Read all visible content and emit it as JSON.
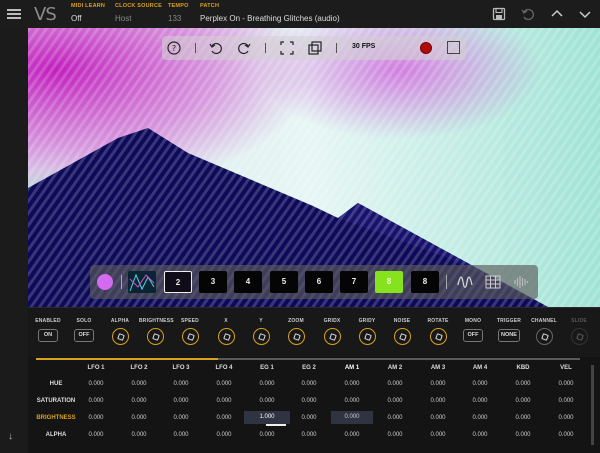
{
  "header": {
    "logo": "VS",
    "fields": [
      {
        "label": "MIDI LEARN",
        "value": "Off"
      },
      {
        "label": "CLOCK SOURCE",
        "value": "Host"
      },
      {
        "label": "TEMPO",
        "value": "133"
      },
      {
        "label": "PATCH",
        "value": "Perplex On - Breathing Glitches (audio)"
      }
    ],
    "icons": [
      "save-icon",
      "undo-icon",
      "chevron-up-icon",
      "chevron-down-icon"
    ]
  },
  "preview_toolbar": {
    "fps": "30 FPS",
    "icons": [
      "help-icon",
      "undo-icon",
      "redo-icon",
      "fullscreen-icon",
      "copy-icon",
      "record-icon",
      "stop-icon"
    ],
    "colors": {
      "record": "#b00c0c"
    }
  },
  "state_bar": {
    "color_swatch": "#d36bf0",
    "slots": [
      "2",
      "3",
      "4",
      "5",
      "6",
      "7",
      "8",
      "8"
    ],
    "selected_slot": "2",
    "highlighted_slot_color": "#86e21d",
    "icons": [
      "waveform-icon",
      "grid-icon",
      "audio-bars-icon"
    ]
  },
  "controls": [
    {
      "label": "ENABLED",
      "type": "button",
      "value": "ON"
    },
    {
      "label": "SOLO",
      "type": "button",
      "value": "OFF"
    },
    {
      "label": "ALPHA",
      "type": "knob"
    },
    {
      "label": "BRIGHTNESS",
      "type": "knob"
    },
    {
      "label": "SPEED",
      "type": "knob"
    },
    {
      "label": "X",
      "type": "knob"
    },
    {
      "label": "Y",
      "type": "knob"
    },
    {
      "label": "ZOOM",
      "type": "knob"
    },
    {
      "label": "GRIDX",
      "type": "knob"
    },
    {
      "label": "GRIDY",
      "type": "knob"
    },
    {
      "label": "NOISE",
      "type": "knob"
    },
    {
      "label": "ROTATE",
      "type": "knob"
    },
    {
      "label": "MONO",
      "type": "button",
      "value": "OFF"
    },
    {
      "label": "TRIGGER",
      "type": "button",
      "value": "NONE"
    },
    {
      "label": "CHANNEL",
      "type": "knob"
    },
    {
      "label": "SLIDE",
      "type": "knob"
    }
  ],
  "matrix": {
    "columns": [
      "LFO 1",
      "LFO 2",
      "LFO 3",
      "LFO 4",
      "EG 1",
      "EG 2",
      "AM 1",
      "AM 2",
      "AM 3",
      "AM 4",
      "KBD",
      "VEL"
    ],
    "rows": [
      {
        "label": "HUE",
        "values": [
          "0.000",
          "0.000",
          "0.000",
          "0.000",
          "0.000",
          "0.000",
          "0.000",
          "0.000",
          "0.000",
          "0.000",
          "0.000",
          "0.000"
        ]
      },
      {
        "label": "SATURATION",
        "values": [
          "0.000",
          "0.000",
          "0.000",
          "0.000",
          "0.000",
          "0.000",
          "0.000",
          "0.000",
          "0.000",
          "0.000",
          "0.000",
          "0.000"
        ]
      },
      {
        "label": "BRIGHTNESS",
        "values": [
          "0.000",
          "0.000",
          "0.000",
          "0.000",
          "1.000",
          "0.000",
          "0.000",
          "0.000",
          "0.000",
          "0.000",
          "0.000",
          "0.000"
        ]
      },
      {
        "label": "ALPHA",
        "values": [
          "0.000",
          "0.000",
          "0.000",
          "0.000",
          "0.000",
          "0.000",
          "0.000",
          "0.000",
          "0.000",
          "0.000",
          "0.000",
          "0.000"
        ]
      }
    ],
    "active_row": "BRIGHTNESS",
    "accent": "#d9a21b"
  }
}
